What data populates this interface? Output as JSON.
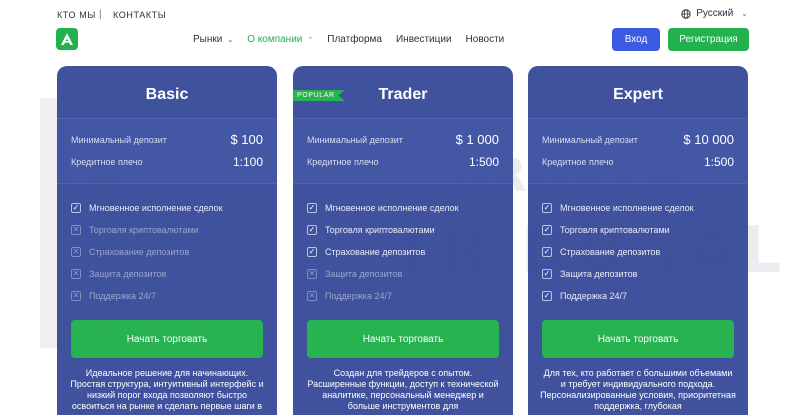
{
  "top": {
    "links": [
      "КТО МЫ",
      "КОНТАКТЫ"
    ],
    "separator": "|",
    "language": "Русский"
  },
  "watermark": {
    "line1": "BROKER",
    "line2": "TRIBUNAL"
  },
  "nav": {
    "items": [
      {
        "label": "Рынки",
        "chevron": "chevron-down"
      },
      {
        "label": "О компании",
        "chevron": "chevron-up",
        "active": true
      },
      {
        "label": "Платформа"
      },
      {
        "label": "Инвестиции"
      },
      {
        "label": "Новости"
      }
    ],
    "login_label": "Вход",
    "register_label": "Регистрация"
  },
  "colors": {
    "accent_green": "#22b14c",
    "card_blue": "#3a4d9a",
    "login_blue": "#3b5be0"
  },
  "plans": [
    {
      "title": "Basic",
      "badge": "",
      "deposit_label": "Минимальный депозит",
      "deposit_value": "$ 100",
      "leverage_label": "Кредитное плечо",
      "leverage_value": "1:100",
      "features": [
        {
          "label": "Мгновенное исполнение сделок",
          "included": true
        },
        {
          "label": "Торговля криптовалютами",
          "included": false
        },
        {
          "label": "Страхование депозитов",
          "included": false
        },
        {
          "label": "Защита депозитов",
          "included": false
        },
        {
          "label": "Поддержка 24/7",
          "included": false
        }
      ],
      "cta": "Начать торговать",
      "description": "Идеальное решение для начинающих. Простая структура, интуитивный интерфейс и низкий порог входа позволяют быстро освоиться на рынке и сделать первые шаги в"
    },
    {
      "title": "Trader",
      "badge": "POPULAR",
      "deposit_label": "Минимальный депозит",
      "deposit_value": "$ 1 000",
      "leverage_label": "Кредитное плечо",
      "leverage_value": "1:500",
      "features": [
        {
          "label": "Мгновенное исполнение сделок",
          "included": true
        },
        {
          "label": "Торговля криптовалютами",
          "included": true
        },
        {
          "label": "Страхование депозитов",
          "included": true
        },
        {
          "label": "Защита депозитов",
          "included": false
        },
        {
          "label": "Поддержка 24/7",
          "included": false
        }
      ],
      "cta": "Начать торговать",
      "description": "Создан для трейдеров с опытом. Расширенные функции, доступ к технической аналитике, персональный менеджер и больше инструментов для"
    },
    {
      "title": "Expert",
      "badge": "",
      "deposit_label": "Минимальный депозит",
      "deposit_value": "$ 10 000",
      "leverage_label": "Кредитное плечо",
      "leverage_value": "1:500",
      "features": [
        {
          "label": "Мгновенное исполнение сделок",
          "included": true
        },
        {
          "label": "Торговля криптовалютами",
          "included": true
        },
        {
          "label": "Страхование депозитов",
          "included": true
        },
        {
          "label": "Защита депозитов",
          "included": true
        },
        {
          "label": "Поддержка 24/7",
          "included": true
        }
      ],
      "cta": "Начать торговать",
      "description": "Для тех, кто работает с большими объемами и требует индивидуального подхода. Персонализированные условия, приоритетная поддержка, глубокая"
    }
  ]
}
